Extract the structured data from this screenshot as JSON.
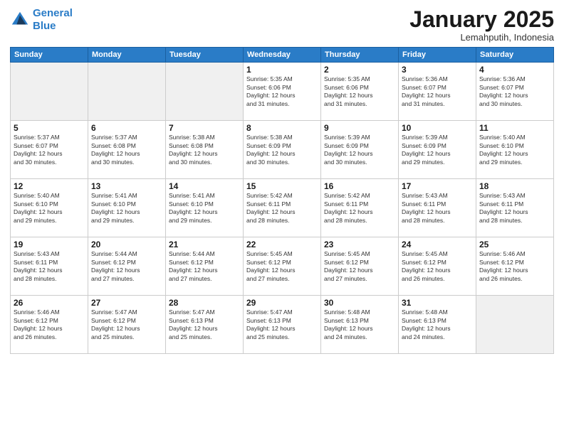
{
  "header": {
    "logo_line1": "General",
    "logo_line2": "Blue",
    "month": "January 2025",
    "location": "Lemahputih, Indonesia"
  },
  "weekdays": [
    "Sunday",
    "Monday",
    "Tuesday",
    "Wednesday",
    "Thursday",
    "Friday",
    "Saturday"
  ],
  "weeks": [
    [
      {
        "day": "",
        "info": ""
      },
      {
        "day": "",
        "info": ""
      },
      {
        "day": "",
        "info": ""
      },
      {
        "day": "1",
        "info": "Sunrise: 5:35 AM\nSunset: 6:06 PM\nDaylight: 12 hours\nand 31 minutes."
      },
      {
        "day": "2",
        "info": "Sunrise: 5:35 AM\nSunset: 6:06 PM\nDaylight: 12 hours\nand 31 minutes."
      },
      {
        "day": "3",
        "info": "Sunrise: 5:36 AM\nSunset: 6:07 PM\nDaylight: 12 hours\nand 31 minutes."
      },
      {
        "day": "4",
        "info": "Sunrise: 5:36 AM\nSunset: 6:07 PM\nDaylight: 12 hours\nand 30 minutes."
      }
    ],
    [
      {
        "day": "5",
        "info": "Sunrise: 5:37 AM\nSunset: 6:07 PM\nDaylight: 12 hours\nand 30 minutes."
      },
      {
        "day": "6",
        "info": "Sunrise: 5:37 AM\nSunset: 6:08 PM\nDaylight: 12 hours\nand 30 minutes."
      },
      {
        "day": "7",
        "info": "Sunrise: 5:38 AM\nSunset: 6:08 PM\nDaylight: 12 hours\nand 30 minutes."
      },
      {
        "day": "8",
        "info": "Sunrise: 5:38 AM\nSunset: 6:09 PM\nDaylight: 12 hours\nand 30 minutes."
      },
      {
        "day": "9",
        "info": "Sunrise: 5:39 AM\nSunset: 6:09 PM\nDaylight: 12 hours\nand 30 minutes."
      },
      {
        "day": "10",
        "info": "Sunrise: 5:39 AM\nSunset: 6:09 PM\nDaylight: 12 hours\nand 29 minutes."
      },
      {
        "day": "11",
        "info": "Sunrise: 5:40 AM\nSunset: 6:10 PM\nDaylight: 12 hours\nand 29 minutes."
      }
    ],
    [
      {
        "day": "12",
        "info": "Sunrise: 5:40 AM\nSunset: 6:10 PM\nDaylight: 12 hours\nand 29 minutes."
      },
      {
        "day": "13",
        "info": "Sunrise: 5:41 AM\nSunset: 6:10 PM\nDaylight: 12 hours\nand 29 minutes."
      },
      {
        "day": "14",
        "info": "Sunrise: 5:41 AM\nSunset: 6:10 PM\nDaylight: 12 hours\nand 29 minutes."
      },
      {
        "day": "15",
        "info": "Sunrise: 5:42 AM\nSunset: 6:11 PM\nDaylight: 12 hours\nand 28 minutes."
      },
      {
        "day": "16",
        "info": "Sunrise: 5:42 AM\nSunset: 6:11 PM\nDaylight: 12 hours\nand 28 minutes."
      },
      {
        "day": "17",
        "info": "Sunrise: 5:43 AM\nSunset: 6:11 PM\nDaylight: 12 hours\nand 28 minutes."
      },
      {
        "day": "18",
        "info": "Sunrise: 5:43 AM\nSunset: 6:11 PM\nDaylight: 12 hours\nand 28 minutes."
      }
    ],
    [
      {
        "day": "19",
        "info": "Sunrise: 5:43 AM\nSunset: 6:11 PM\nDaylight: 12 hours\nand 28 minutes."
      },
      {
        "day": "20",
        "info": "Sunrise: 5:44 AM\nSunset: 6:12 PM\nDaylight: 12 hours\nand 27 minutes."
      },
      {
        "day": "21",
        "info": "Sunrise: 5:44 AM\nSunset: 6:12 PM\nDaylight: 12 hours\nand 27 minutes."
      },
      {
        "day": "22",
        "info": "Sunrise: 5:45 AM\nSunset: 6:12 PM\nDaylight: 12 hours\nand 27 minutes."
      },
      {
        "day": "23",
        "info": "Sunrise: 5:45 AM\nSunset: 6:12 PM\nDaylight: 12 hours\nand 27 minutes."
      },
      {
        "day": "24",
        "info": "Sunrise: 5:45 AM\nSunset: 6:12 PM\nDaylight: 12 hours\nand 26 minutes."
      },
      {
        "day": "25",
        "info": "Sunrise: 5:46 AM\nSunset: 6:12 PM\nDaylight: 12 hours\nand 26 minutes."
      }
    ],
    [
      {
        "day": "26",
        "info": "Sunrise: 5:46 AM\nSunset: 6:12 PM\nDaylight: 12 hours\nand 26 minutes."
      },
      {
        "day": "27",
        "info": "Sunrise: 5:47 AM\nSunset: 6:12 PM\nDaylight: 12 hours\nand 25 minutes."
      },
      {
        "day": "28",
        "info": "Sunrise: 5:47 AM\nSunset: 6:13 PM\nDaylight: 12 hours\nand 25 minutes."
      },
      {
        "day": "29",
        "info": "Sunrise: 5:47 AM\nSunset: 6:13 PM\nDaylight: 12 hours\nand 25 minutes."
      },
      {
        "day": "30",
        "info": "Sunrise: 5:48 AM\nSunset: 6:13 PM\nDaylight: 12 hours\nand 24 minutes."
      },
      {
        "day": "31",
        "info": "Sunrise: 5:48 AM\nSunset: 6:13 PM\nDaylight: 12 hours\nand 24 minutes."
      },
      {
        "day": "",
        "info": ""
      }
    ]
  ]
}
